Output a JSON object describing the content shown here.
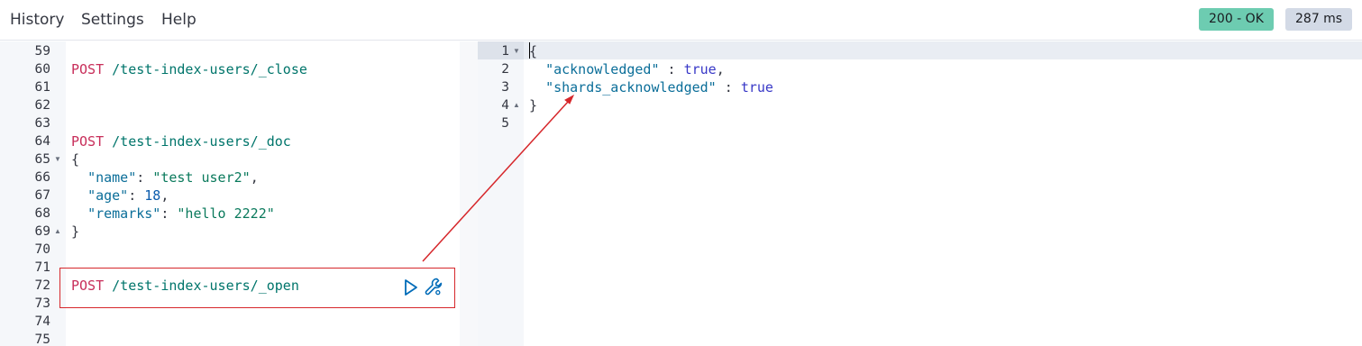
{
  "menu": {
    "history": "History",
    "settings": "Settings",
    "help": "Help"
  },
  "status": {
    "code": "200 - OK",
    "time": "287 ms"
  },
  "request": {
    "line_numbers": [
      "59",
      "60",
      "61",
      "62",
      "63",
      "64",
      "65",
      "66",
      "67",
      "68",
      "69",
      "70",
      "71",
      "72",
      "73",
      "74",
      "75"
    ],
    "close_method": "POST",
    "close_path": "/test-index-users/_close",
    "doc_method": "POST",
    "doc_path": "/test-index-users/_doc",
    "doc_open_brace": "{",
    "doc_name_key": "\"name\"",
    "doc_name_value": "\"test user2\"",
    "doc_age_key": "\"age\"",
    "doc_age_value": "18",
    "doc_remarks_key": "\"remarks\"",
    "doc_remarks_value": "\"hello 2222\"",
    "doc_close_brace": "}",
    "open_method": "POST",
    "open_path": "/test-index-users/_open"
  },
  "response": {
    "line_numbers": [
      "1",
      "2",
      "3",
      "4",
      "5"
    ],
    "open_brace": "{",
    "acknowledged_key": "\"acknowledged\"",
    "acknowledged_value": "true",
    "shards_key": "\"shards_acknowledged\"",
    "shards_value": "true",
    "close_brace": "}"
  },
  "icons": {
    "run": "play-icon",
    "wrench": "wrench-icon",
    "fold": "fold-caret-icon"
  },
  "colors": {
    "status_ok": "#6dccb1",
    "time_badge": "#d3dae6",
    "annotation": "#d6272b",
    "method": "#c82e5a",
    "path": "#00756b"
  }
}
